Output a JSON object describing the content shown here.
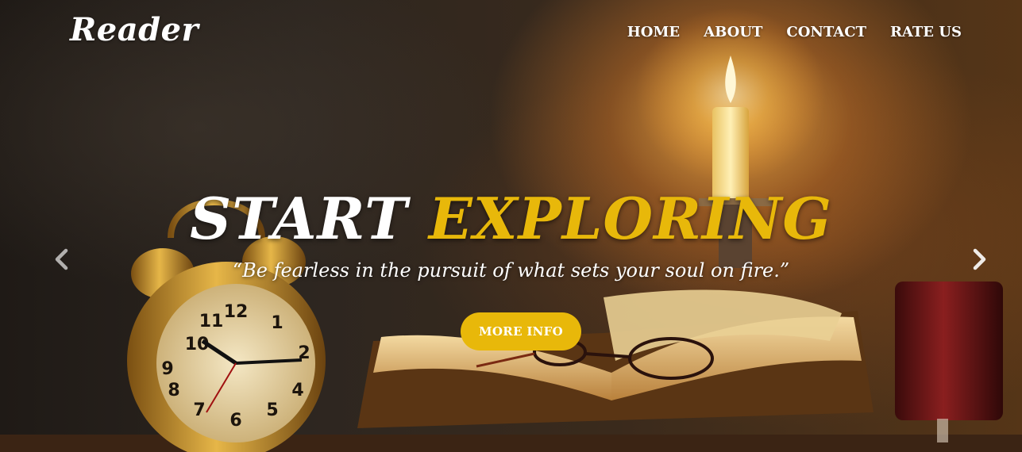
{
  "brand": {
    "name": "Reader"
  },
  "nav": {
    "items": [
      {
        "label": "HOME"
      },
      {
        "label": "ABOUT"
      },
      {
        "label": "CONTACT"
      },
      {
        "label": "RATE US"
      }
    ]
  },
  "hero": {
    "headline_word1": "START",
    "headline_word2": "EXPLORING",
    "quote": "“Be fearless in the pursuit of what sets your soul on fire.”",
    "button_label": "MORE INFO"
  },
  "carousel": {
    "prev_icon": "chevron-left-icon",
    "next_icon": "chevron-right-icon"
  },
  "colors": {
    "accent": "#e8b80a",
    "text": "#ffffff"
  }
}
